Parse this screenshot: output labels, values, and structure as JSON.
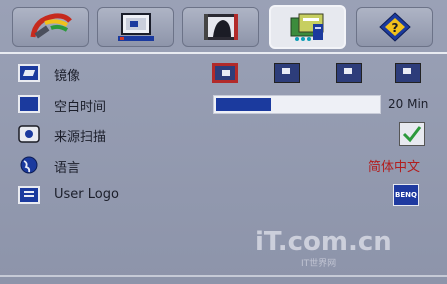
{
  "tabs": [
    {
      "id": "picture",
      "icon": "palette-brush-icon"
    },
    {
      "id": "display",
      "icon": "monitor-icon"
    },
    {
      "id": "image",
      "icon": "film-image-icon"
    },
    {
      "id": "setup",
      "icon": "setup-folder-icon",
      "active": true
    },
    {
      "id": "information",
      "icon": "help-diamond-icon"
    }
  ],
  "menu": {
    "mirror": {
      "label": "镜像",
      "icon": "mirror-icon",
      "options": [
        "front-table",
        "rear-table",
        "front-ceiling",
        "rear-ceiling"
      ],
      "selected": 0
    },
    "blank_time": {
      "label": "空白时间",
      "icon": "blank-screen-icon",
      "value": "20 Min",
      "level": 0.34
    },
    "source_scan": {
      "label": "来源扫描",
      "icon": "source-scan-icon",
      "checked": true
    },
    "language": {
      "label": "语言",
      "icon": "globe-icon",
      "value": "简体中文"
    },
    "user_logo": {
      "label": "User Logo",
      "icon": "logo-icon",
      "value_icon": "benq-logo-icon"
    }
  },
  "watermark": {
    "text": "iT.com.cn",
    "sub": "IT世界网"
  },
  "colors": {
    "background": "#9097ac",
    "accent": "#1b3a9e",
    "selection": "#b22a2a",
    "language_text": "#b21e1e"
  }
}
